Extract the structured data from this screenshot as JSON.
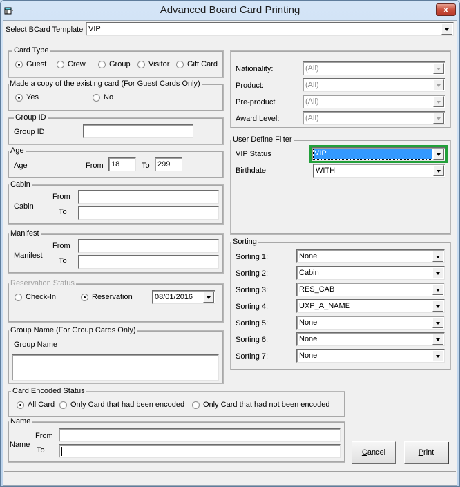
{
  "window": {
    "title": "Advanced Board Card Printing",
    "close_label": "x"
  },
  "template": {
    "label": "Select BCard Template",
    "value": "VIP"
  },
  "card_type": {
    "title": "Card Type",
    "options": [
      {
        "label": "Guest",
        "checked": true
      },
      {
        "label": "Crew",
        "checked": false
      },
      {
        "label": "Group",
        "checked": false
      },
      {
        "label": "Visitor",
        "checked": false
      },
      {
        "label": "Gift Card",
        "checked": false
      }
    ]
  },
  "copy_card": {
    "title": "Made a copy of the existing card (For Guest Cards Only)",
    "options": [
      {
        "label": "Yes",
        "checked": true
      },
      {
        "label": "No",
        "checked": false
      }
    ]
  },
  "group_id": {
    "title": "Group ID",
    "label": "Group ID",
    "value": ""
  },
  "age": {
    "title": "Age",
    "label": "Age",
    "from_label": "From",
    "from_value": "18",
    "to_label": "To",
    "to_value": "299"
  },
  "cabin": {
    "title": "Cabin",
    "label": "Cabin",
    "from_label": "From",
    "from_value": "",
    "to_label": "To",
    "to_value": ""
  },
  "manifest": {
    "title": "Manifest",
    "label": "Manifest",
    "from_label": "From",
    "from_value": "",
    "to_label": "To",
    "to_value": ""
  },
  "reservation_status": {
    "title": "Reservation Status",
    "options": [
      {
        "label": "Check-In",
        "checked": false
      },
      {
        "label": "Reservation",
        "checked": true
      }
    ],
    "date": "08/01/2016"
  },
  "group_name": {
    "title": "Group Name (For Group Cards Only)",
    "label": "Group Name",
    "value": ""
  },
  "card_encoded": {
    "title": "Card Encoded Status",
    "options": [
      {
        "label": "All Card",
        "checked": true
      },
      {
        "label": "Only Card that had been encoded",
        "checked": false
      },
      {
        "label": "Only Card that had not been encoded",
        "checked": false
      }
    ]
  },
  "name": {
    "title": "Name",
    "label": "Name",
    "from_label": "From",
    "from_value": "",
    "to_label": "To",
    "to_value": ""
  },
  "filters": [
    {
      "label": "Nationality:",
      "value": "(All)"
    },
    {
      "label": "Product:",
      "value": "(All)"
    },
    {
      "label": "Pre-product",
      "value": "(All)"
    },
    {
      "label": "Award Level:",
      "value": "(All)"
    }
  ],
  "user_define_filter": {
    "title": "User Define Filter",
    "vip_label": "VIP Status",
    "vip_value": "VIP",
    "birthdate_label": "Birthdate",
    "birthdate_value": "WITH"
  },
  "sorting": {
    "title": "Sorting",
    "items": [
      {
        "label": "Sorting 1:",
        "value": "None"
      },
      {
        "label": "Sorting 2:",
        "value": "Cabin"
      },
      {
        "label": "Sorting 3:",
        "value": "RES_CAB"
      },
      {
        "label": "Sorting 4:",
        "value": "UXP_A_NAME"
      },
      {
        "label": "Sorting 5:",
        "value": "None"
      },
      {
        "label": "Sorting 6:",
        "value": "None"
      },
      {
        "label": "Sorting 7:",
        "value": "None"
      }
    ]
  },
  "buttons": {
    "cancel_accel": "C",
    "cancel_rest": "ancel",
    "print_accel": "P",
    "print_rest": "rint"
  },
  "accent": {
    "focus_ring": "#22a03a",
    "selection": "#3399ff"
  }
}
